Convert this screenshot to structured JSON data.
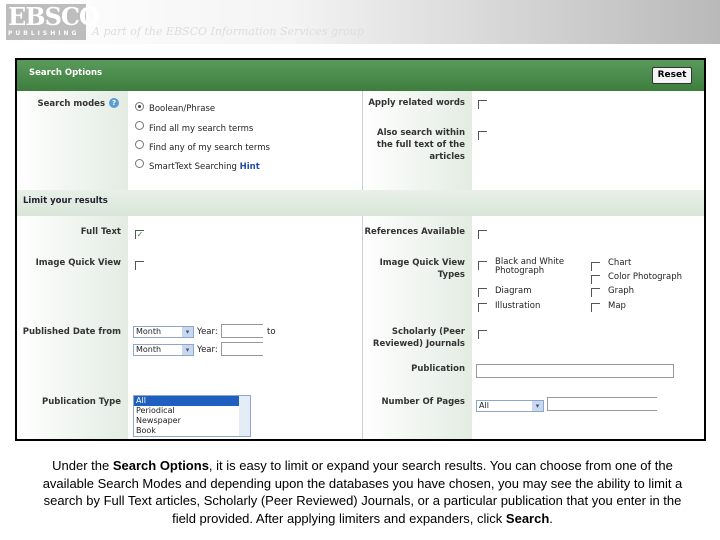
{
  "banner": {
    "logo": "EBSCO",
    "logo_sub": "PUBLISHING",
    "tagline": "A part of the EBSCO Information Services group"
  },
  "search_options": {
    "title": "Search Options",
    "reset": "Reset",
    "modes_label": "Search modes",
    "help_icon": "?",
    "modes": [
      {
        "label": "Boolean/Phrase",
        "selected": true
      },
      {
        "label": "Find all my search terms",
        "selected": false
      },
      {
        "label": "Find any of my search terms",
        "selected": false
      },
      {
        "label": "SmartText Searching",
        "selected": false
      }
    ],
    "hint": "Hint",
    "apply_related": "Apply related words",
    "also_search": "Also search within the full text of the articles"
  },
  "limits": {
    "title": "Limit your results",
    "full_text": "Full Text",
    "full_text_checked": true,
    "image_quick_view": "Image Quick View",
    "published_date": "Published Date from",
    "month": "Month",
    "year": "Year:",
    "to": "to",
    "publication_type": "Publication Type",
    "pub_types": [
      "All",
      "Periodical",
      "Newspaper",
      "Book"
    ],
    "references": "References Available",
    "iqv_types": "Image Quick View Types",
    "types": [
      "Black and White Photograph",
      "Chart",
      "Color Photograph",
      "Diagram",
      "Graph",
      "Illustration",
      "Map"
    ],
    "scholarly": "Scholarly (Peer Reviewed) Journals",
    "publication": "Publication",
    "pages": "Number Of Pages",
    "pages_value": "All"
  },
  "caption": {
    "p1": "Under the ",
    "b1": "Search Options",
    "p2": ", it is easy to limit or expand your search results. You can choose from one of the available Search Modes and depending upon the databases you have chosen, you may see the ability to limit a search by Full Text articles, Scholarly (Peer Reviewed) Journals, or a particular publication that you enter in the field provided. After applying limiters and expanders, click ",
    "b2": "Search",
    "p3": "."
  }
}
